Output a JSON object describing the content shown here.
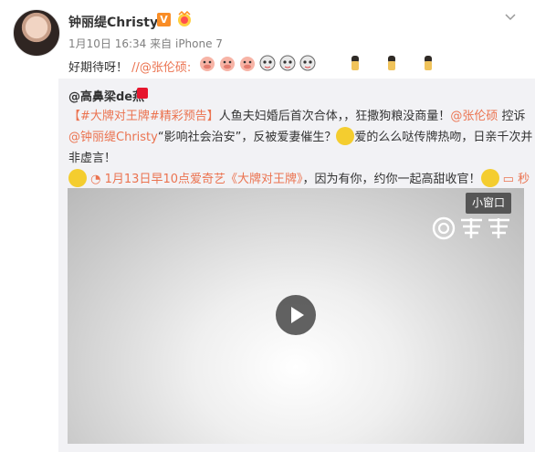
{
  "post": {
    "author": "钟丽缇Christy",
    "vip_badge": "V",
    "date": "1月10日 16:34",
    "source_prefix": "来自",
    "source": "iPhone 7",
    "text_prefix": "好期待呀！",
    "mention": "//@张伦硕:"
  },
  "repost": {
    "author": "@高鼻梁de燕",
    "hashtag": "【#大牌对王牌#精彩预告】",
    "text_part1": "人鱼夫妇婚后首次合体，，狂撒狗粮没商量！",
    "mention1": "@张伦硕",
    "text_part2": "控诉",
    "mention2": "@钟丽缇Christy",
    "text_part3": "“影响社会治安”，反被爱妻催生？",
    "text_part4": "爱的么么哒传牌热吻，日亲千次并非虚言！",
    "link1": "1月13日早10点爱奇艺《大牌对王牌》",
    "text_part5": "，因为有你，约你一起高甜收官！",
    "link2": "秒拍视频",
    "text_end": "."
  },
  "video": {
    "mini_window_label": "小窗口"
  }
}
